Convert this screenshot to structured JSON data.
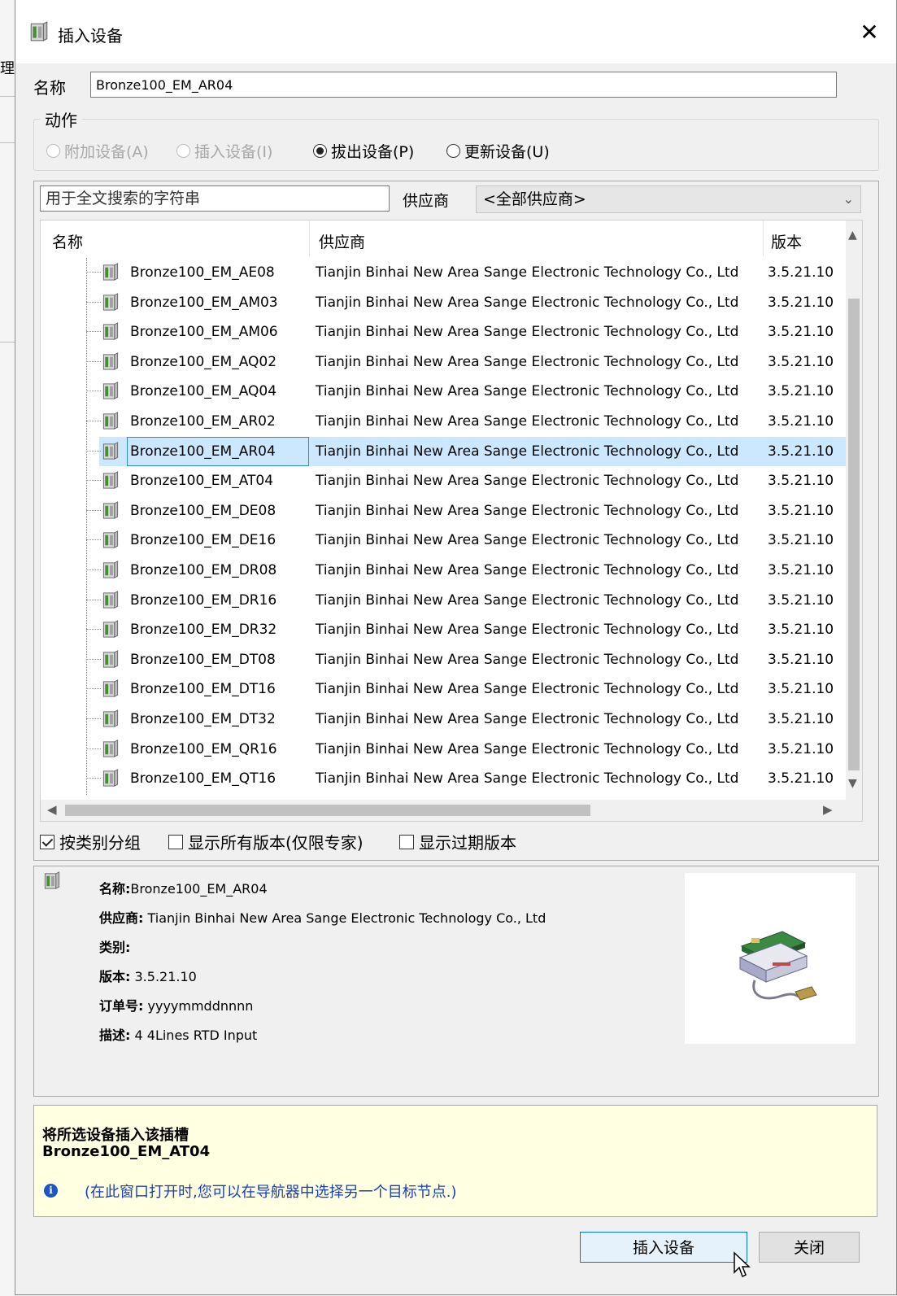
{
  "outer": {
    "fragment": "理"
  },
  "window": {
    "title": "插入设备",
    "close_glyph": "✕"
  },
  "name_field": {
    "label": "名称",
    "value": "Bronze100_EM_AR04"
  },
  "action": {
    "legend": "动作",
    "options": [
      {
        "label": "附加设备(A)",
        "enabled": false,
        "checked": false
      },
      {
        "label": "插入设备(I)",
        "enabled": false,
        "checked": false
      },
      {
        "label": "拔出设备(P)",
        "enabled": true,
        "checked": true
      },
      {
        "label": "更新设备(U)",
        "enabled": true,
        "checked": false
      }
    ]
  },
  "search": {
    "placeholder": "用于全文搜索的字符串",
    "vendor_label": "供应商",
    "vendor_selected": "<全部供应商>"
  },
  "table": {
    "columns": {
      "name": "名称",
      "vendor": "供应商",
      "version": "版本"
    },
    "vendor": "Tianjin Binhai New Area Sange Electronic Technology Co., Ltd",
    "version": "3.5.21.10",
    "rows": [
      "Bronze100_EM_AE08",
      "Bronze100_EM_AM03",
      "Bronze100_EM_AM06",
      "Bronze100_EM_AQ02",
      "Bronze100_EM_AQ04",
      "Bronze100_EM_AR02",
      "Bronze100_EM_AR04",
      "Bronze100_EM_AT04",
      "Bronze100_EM_DE08",
      "Bronze100_EM_DE16",
      "Bronze100_EM_DR08",
      "Bronze100_EM_DR16",
      "Bronze100_EM_DR32",
      "Bronze100_EM_DT08",
      "Bronze100_EM_DT16",
      "Bronze100_EM_DT32",
      "Bronze100_EM_QR16",
      "Bronze100_EM_QT16"
    ],
    "selected_index": 6
  },
  "options": {
    "group_by_category": "按类别分组",
    "show_all_versions": "显示所有版本(仅限专家)",
    "show_outdated": "显示过期版本"
  },
  "details": {
    "name_label": "名称:",
    "name": "Bronze100_EM_AR04",
    "vendor_label": "供应商:",
    "vendor": "Tianjin Binhai New Area Sange Electronic Technology Co., Ltd",
    "category_label": "类别:",
    "version_label": "版本:",
    "version": "3.5.21.10",
    "order_label": "订单号:",
    "order": "yyyymmddnnnn",
    "desc_label": "描述:",
    "desc": "4 4Lines RTD Input"
  },
  "info": {
    "line1": "将所选设备插入该插槽",
    "line2": "Bronze100_EM_AT04",
    "hint": "(在此窗口打开时,您可以在导航器中选择另一个目标节点.)",
    "icon_glyph": "i"
  },
  "buttons": {
    "insert": "插入设备",
    "close": "关闭"
  }
}
